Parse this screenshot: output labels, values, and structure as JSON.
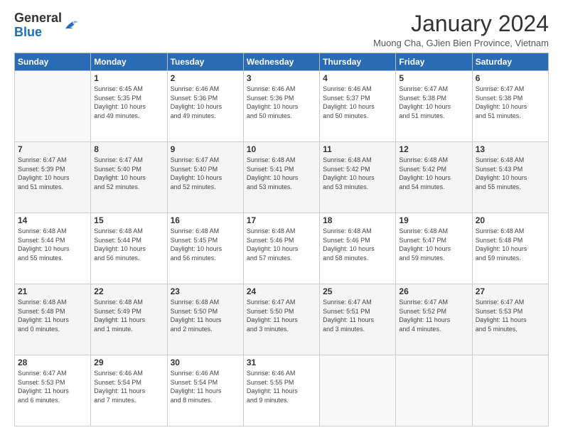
{
  "logo": {
    "general": "General",
    "blue": "Blue"
  },
  "header": {
    "month_year": "January 2024",
    "location": "Muong Cha, GJien Bien Province, Vietnam"
  },
  "days_of_week": [
    "Sunday",
    "Monday",
    "Tuesday",
    "Wednesday",
    "Thursday",
    "Friday",
    "Saturday"
  ],
  "weeks": [
    [
      {
        "num": "",
        "info": ""
      },
      {
        "num": "1",
        "info": "Sunrise: 6:45 AM\nSunset: 5:35 PM\nDaylight: 10 hours\nand 49 minutes."
      },
      {
        "num": "2",
        "info": "Sunrise: 6:46 AM\nSunset: 5:36 PM\nDaylight: 10 hours\nand 49 minutes."
      },
      {
        "num": "3",
        "info": "Sunrise: 6:46 AM\nSunset: 5:36 PM\nDaylight: 10 hours\nand 50 minutes."
      },
      {
        "num": "4",
        "info": "Sunrise: 6:46 AM\nSunset: 5:37 PM\nDaylight: 10 hours\nand 50 minutes."
      },
      {
        "num": "5",
        "info": "Sunrise: 6:47 AM\nSunset: 5:38 PM\nDaylight: 10 hours\nand 51 minutes."
      },
      {
        "num": "6",
        "info": "Sunrise: 6:47 AM\nSunset: 5:38 PM\nDaylight: 10 hours\nand 51 minutes."
      }
    ],
    [
      {
        "num": "7",
        "info": "Sunrise: 6:47 AM\nSunset: 5:39 PM\nDaylight: 10 hours\nand 51 minutes."
      },
      {
        "num": "8",
        "info": "Sunrise: 6:47 AM\nSunset: 5:40 PM\nDaylight: 10 hours\nand 52 minutes."
      },
      {
        "num": "9",
        "info": "Sunrise: 6:47 AM\nSunset: 5:40 PM\nDaylight: 10 hours\nand 52 minutes."
      },
      {
        "num": "10",
        "info": "Sunrise: 6:48 AM\nSunset: 5:41 PM\nDaylight: 10 hours\nand 53 minutes."
      },
      {
        "num": "11",
        "info": "Sunrise: 6:48 AM\nSunset: 5:42 PM\nDaylight: 10 hours\nand 53 minutes."
      },
      {
        "num": "12",
        "info": "Sunrise: 6:48 AM\nSunset: 5:42 PM\nDaylight: 10 hours\nand 54 minutes."
      },
      {
        "num": "13",
        "info": "Sunrise: 6:48 AM\nSunset: 5:43 PM\nDaylight: 10 hours\nand 55 minutes."
      }
    ],
    [
      {
        "num": "14",
        "info": "Sunrise: 6:48 AM\nSunset: 5:44 PM\nDaylight: 10 hours\nand 55 minutes."
      },
      {
        "num": "15",
        "info": "Sunrise: 6:48 AM\nSunset: 5:44 PM\nDaylight: 10 hours\nand 56 minutes."
      },
      {
        "num": "16",
        "info": "Sunrise: 6:48 AM\nSunset: 5:45 PM\nDaylight: 10 hours\nand 56 minutes."
      },
      {
        "num": "17",
        "info": "Sunrise: 6:48 AM\nSunset: 5:46 PM\nDaylight: 10 hours\nand 57 minutes."
      },
      {
        "num": "18",
        "info": "Sunrise: 6:48 AM\nSunset: 5:46 PM\nDaylight: 10 hours\nand 58 minutes."
      },
      {
        "num": "19",
        "info": "Sunrise: 6:48 AM\nSunset: 5:47 PM\nDaylight: 10 hours\nand 59 minutes."
      },
      {
        "num": "20",
        "info": "Sunrise: 6:48 AM\nSunset: 5:48 PM\nDaylight: 10 hours\nand 59 minutes."
      }
    ],
    [
      {
        "num": "21",
        "info": "Sunrise: 6:48 AM\nSunset: 5:48 PM\nDaylight: 11 hours\nand 0 minutes."
      },
      {
        "num": "22",
        "info": "Sunrise: 6:48 AM\nSunset: 5:49 PM\nDaylight: 11 hours\nand 1 minute."
      },
      {
        "num": "23",
        "info": "Sunrise: 6:48 AM\nSunset: 5:50 PM\nDaylight: 11 hours\nand 2 minutes."
      },
      {
        "num": "24",
        "info": "Sunrise: 6:47 AM\nSunset: 5:50 PM\nDaylight: 11 hours\nand 3 minutes."
      },
      {
        "num": "25",
        "info": "Sunrise: 6:47 AM\nSunset: 5:51 PM\nDaylight: 11 hours\nand 3 minutes."
      },
      {
        "num": "26",
        "info": "Sunrise: 6:47 AM\nSunset: 5:52 PM\nDaylight: 11 hours\nand 4 minutes."
      },
      {
        "num": "27",
        "info": "Sunrise: 6:47 AM\nSunset: 5:53 PM\nDaylight: 11 hours\nand 5 minutes."
      }
    ],
    [
      {
        "num": "28",
        "info": "Sunrise: 6:47 AM\nSunset: 5:53 PM\nDaylight: 11 hours\nand 6 minutes."
      },
      {
        "num": "29",
        "info": "Sunrise: 6:46 AM\nSunset: 5:54 PM\nDaylight: 11 hours\nand 7 minutes."
      },
      {
        "num": "30",
        "info": "Sunrise: 6:46 AM\nSunset: 5:54 PM\nDaylight: 11 hours\nand 8 minutes."
      },
      {
        "num": "31",
        "info": "Sunrise: 6:46 AM\nSunset: 5:55 PM\nDaylight: 11 hours\nand 9 minutes."
      },
      {
        "num": "",
        "info": ""
      },
      {
        "num": "",
        "info": ""
      },
      {
        "num": "",
        "info": ""
      }
    ]
  ]
}
